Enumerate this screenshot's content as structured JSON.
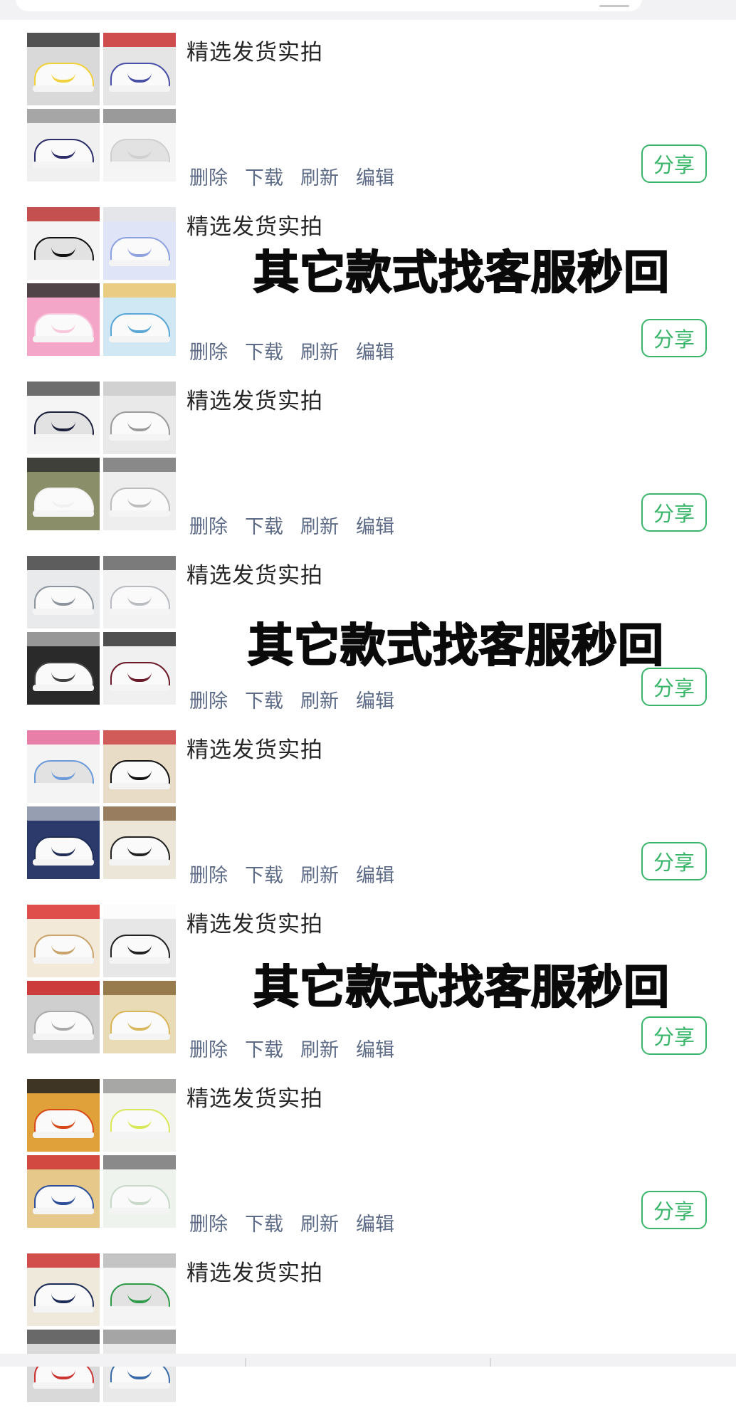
{
  "colors": {
    "accent_green": "#39b56a",
    "action_link": "#5d6b86",
    "title_text": "#262626",
    "overlay_text": "#0a0a0a"
  },
  "posts": [
    {
      "title": "精选发货实拍",
      "thumb_colors": [
        [
          "#d9d9d9",
          "#f2d23a",
          "#3a3a3a"
        ],
        [
          "#e5e5e5",
          "#4a4fa8",
          "#c33"
        ],
        [
          "#f0f0f0",
          "#2d2d6a",
          "#999"
        ],
        [
          "#f5f5f5",
          "#cfcfcf",
          "#8a8a8a"
        ]
      ]
    },
    {
      "title": "精选发货实拍",
      "thumb_colors": [
        [
          "#f4f4f4",
          "#111111",
          "#b33"
        ],
        [
          "#dfe4f7",
          "#8fa2e0",
          "#e6e6e6"
        ],
        [
          "#f4a6c9",
          "#f7c7dc",
          "#333"
        ],
        [
          "#cfe8f4",
          "#5aa7d6",
          "#f0c770"
        ]
      ]
    },
    {
      "title": "精选发货实拍",
      "thumb_colors": [
        [
          "#f5f5f5",
          "#1b1f3a",
          "#555"
        ],
        [
          "#e9e9e9",
          "#9a9a9a",
          "#ccc"
        ],
        [
          "#8a8f6a",
          "#f1f1f1",
          "#333"
        ],
        [
          "#eeeeee",
          "#bdbdbd",
          "#777"
        ]
      ]
    },
    {
      "title": "精选发货实拍",
      "thumb_colors": [
        [
          "#e8eaec",
          "#8d949c",
          "#444"
        ],
        [
          "#f2f2f2",
          "#b9bcc0",
          "#666"
        ],
        [
          "#2a2a2a",
          "#444444",
          "#aaa"
        ],
        [
          "#f0f0f0",
          "#6b1a2a",
          "#333"
        ]
      ]
    },
    {
      "title": "精选发货实拍",
      "thumb_colors": [
        [
          "#f4f4f4",
          "#6a9ad8",
          "#e46a9a"
        ],
        [
          "#e9dcc6",
          "#111111",
          "#c44"
        ],
        [
          "#2b3a6b",
          "#1f2d55",
          "#a9b0bd"
        ],
        [
          "#ece6d8",
          "#222222",
          "#8a6a4a"
        ]
      ]
    },
    {
      "title": "精选发货实拍",
      "thumb_colors": [
        [
          "#f2e9d8",
          "#c9a36a",
          "#d33"
        ],
        [
          "#e7e7e7",
          "#222222",
          "#ffffff"
        ],
        [
          "#cfcfcf",
          "#a9a9a9",
          "#c22"
        ],
        [
          "#e9dbb6",
          "#d9b65a",
          "#8a6a3a"
        ]
      ]
    },
    {
      "title": "精选发货实拍",
      "thumb_colors": [
        [
          "#e0a03a",
          "#d94a1a",
          "#222"
        ],
        [
          "#f3f3f0",
          "#d9e85a",
          "#999"
        ],
        [
          "#e6c98a",
          "#2d4f9a",
          "#c33"
        ],
        [
          "#eef3ee",
          "#c9d9c9",
          "#777"
        ]
      ]
    },
    {
      "title": "精选发货实拍",
      "thumb_colors": [
        [
          "#efe9dc",
          "#1c2b55",
          "#c33"
        ],
        [
          "#f4f4f4",
          "#2f9a4a",
          "#bbb"
        ],
        [
          "#d9d9d9",
          "#c33",
          "#555"
        ],
        [
          "#e9e9e9",
          "#3a6aa8",
          "#999"
        ]
      ]
    }
  ],
  "actions": {
    "delete": "删除",
    "download": "下载",
    "refresh": "刷新",
    "edit": "编辑"
  },
  "share_label": "分享",
  "overlay_text": "其它款式找客服秒回"
}
